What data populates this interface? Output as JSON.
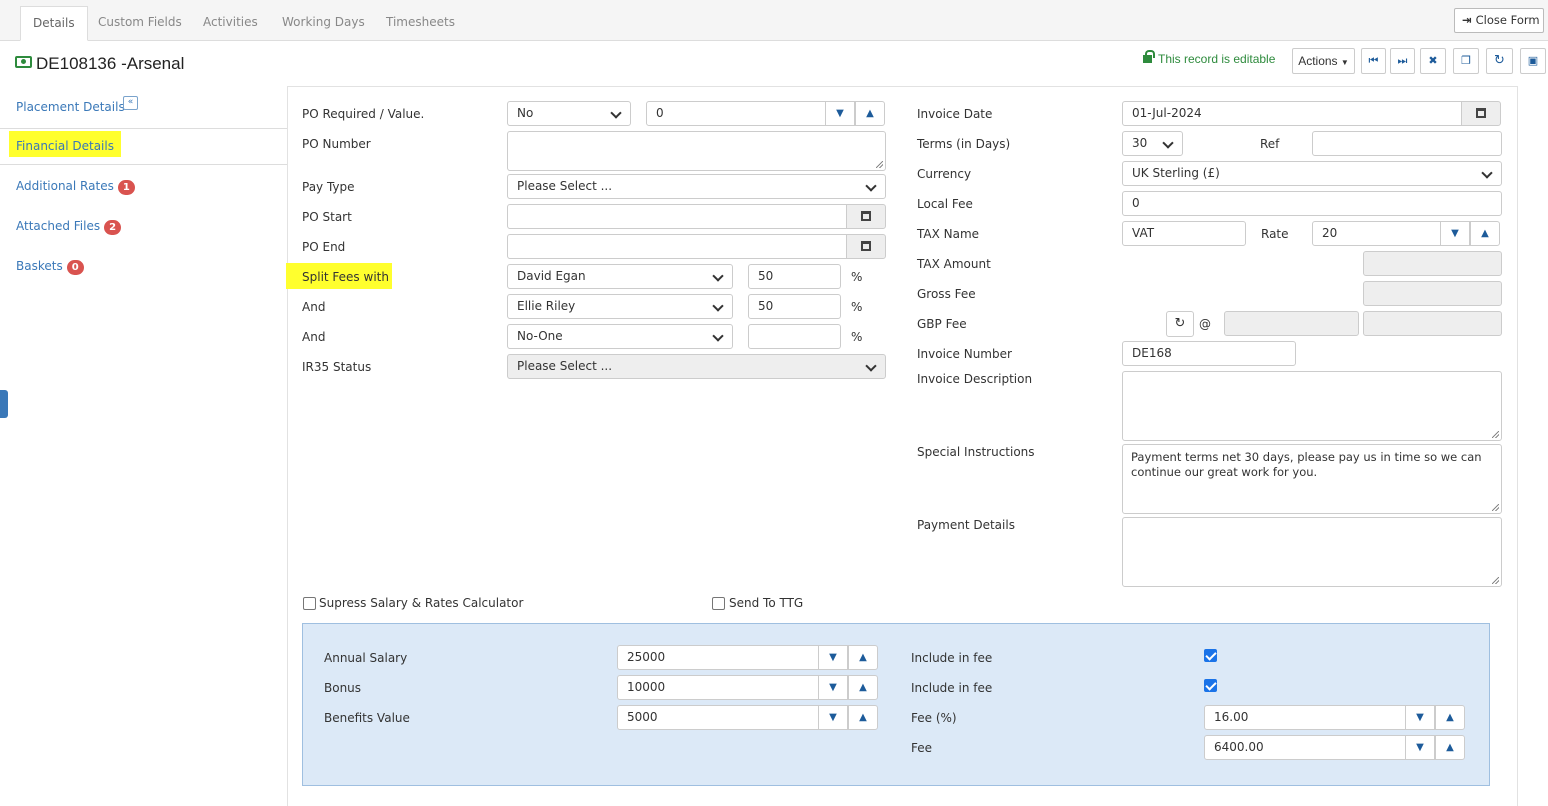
{
  "tabs": [
    "Details",
    "Custom Fields",
    "Activities",
    "Working Days",
    "Timesheets"
  ],
  "close_form": "Close Form",
  "record": {
    "title": "DE108136 -Arsenal",
    "editable_text": "This record is editable",
    "actions_label": "Actions"
  },
  "sidebar": {
    "items": [
      {
        "label": "Placement Details"
      },
      {
        "label": "Financial Details"
      },
      {
        "label": "Additional Rates",
        "badge": "1"
      },
      {
        "label": "Attached Files",
        "badge": "2"
      },
      {
        "label": "Baskets",
        "badge": "0"
      }
    ]
  },
  "left": {
    "po_required_label": "PO Required / Value.",
    "po_required_value": "No",
    "po_value": "0",
    "po_number_label": "PO Number",
    "pay_type_label": "Pay Type",
    "pay_type_value": "Please Select ...",
    "po_start_label": "PO Start",
    "po_end_label": "PO End",
    "split_fees_label": "Split Fees with",
    "and_label": "And",
    "and2_label": "And",
    "split1_name": "David Egan",
    "split1_pct": "50",
    "split2_name": "Ellie Riley",
    "split2_pct": "50",
    "split3_name": "No-One",
    "split3_pct": "",
    "pct_symbol": "%",
    "ir35_label": "IR35 Status",
    "ir35_value": "Please Select ..."
  },
  "right": {
    "invoice_date_label": "Invoice Date",
    "invoice_date_value": "01-Jul-2024",
    "terms_label": "Terms (in Days)",
    "terms_value": "30",
    "ref_label": "Ref",
    "currency_label": "Currency",
    "currency_value": "UK Sterling (£)",
    "local_fee_label": "Local Fee",
    "local_fee_value": "0",
    "tax_name_label": "TAX Name",
    "tax_name_value": "VAT",
    "rate_label": "Rate",
    "rate_value": "20",
    "tax_amount_label": "TAX Amount",
    "gross_fee_label": "Gross Fee",
    "gbp_fee_label": "GBP Fee",
    "at_symbol": "@",
    "invoice_number_label": "Invoice Number",
    "invoice_number_value": "DE168",
    "invoice_desc_label": "Invoice Description",
    "special_label": "Special Instructions",
    "special_value": "Payment terms net 30 days, please pay us in time so we can continue our great work for you.",
    "payment_details_label": "Payment Details"
  },
  "checks": {
    "suppress_label": "Supress Salary & Rates Calculator",
    "send_ttg_label": "Send To TTG"
  },
  "calc": {
    "annual_salary_label": "Annual Salary",
    "annual_salary_value": "25000",
    "bonus_label": "Bonus",
    "bonus_value": "10000",
    "benefits_label": "Benefits Value",
    "benefits_value": "5000",
    "include1_label": "Include in fee",
    "include2_label": "Include in fee",
    "fee_pct_label": "Fee (%)",
    "fee_pct_value": "16.00",
    "fee_label": "Fee",
    "fee_value": "6400.00"
  }
}
